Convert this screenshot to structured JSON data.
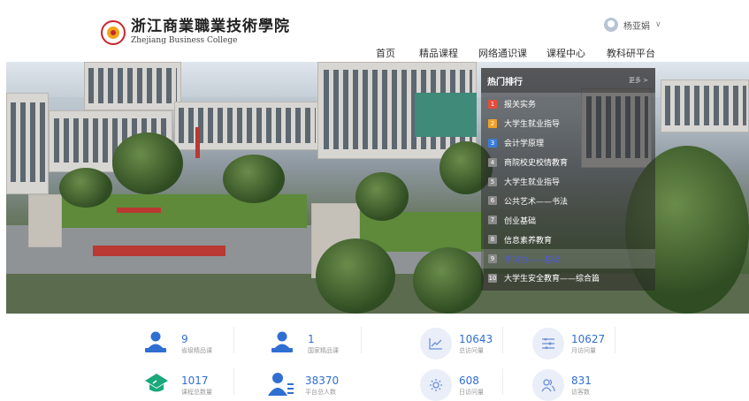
{
  "header": {
    "logo_cn": "浙江商業職業技術學院",
    "logo_en": "Zhejiang Business College",
    "user_name": "杨亚娟"
  },
  "nav": {
    "items": [
      "首页",
      "精品课程",
      "网络通识课",
      "课程中心",
      "教科研平台"
    ]
  },
  "ranking": {
    "title": "热门排行",
    "more": "更多 >",
    "items": [
      {
        "num": "1",
        "label": "报关实务"
      },
      {
        "num": "2",
        "label": "大学生就业指导"
      },
      {
        "num": "3",
        "label": "会计学原理"
      },
      {
        "num": "4",
        "label": "商院校史校情教育"
      },
      {
        "num": "5",
        "label": "大学生就业指导"
      },
      {
        "num": "6",
        "label": "公共艺术——书法"
      },
      {
        "num": "7",
        "label": "创业基础"
      },
      {
        "num": "8",
        "label": "信息素养教育"
      },
      {
        "num": "9",
        "label": "学习力——基础"
      },
      {
        "num": "10",
        "label": "大学生安全教育——综合篇"
      }
    ]
  },
  "stats": {
    "provincial_courses": {
      "value": "9",
      "label": "省级精品课"
    },
    "national_courses": {
      "value": "1",
      "label": "国家精品课"
    },
    "total_visits": {
      "value": "10643",
      "label": "总访问量"
    },
    "monthly_visits": {
      "value": "10627",
      "label": "月访问量"
    },
    "total_courses": {
      "value": "1017",
      "label": "课程总数量"
    },
    "total_users": {
      "value": "38370",
      "label": "平台总人数"
    },
    "daily_visits": {
      "value": "608",
      "label": "日访问量"
    },
    "visitors": {
      "value": "831",
      "label": "访客数"
    }
  },
  "colors": {
    "accent": "#2f6fd2",
    "rank1": "#e54c3c",
    "rank2": "#f0a12a",
    "rank3": "#3b7dd8"
  }
}
